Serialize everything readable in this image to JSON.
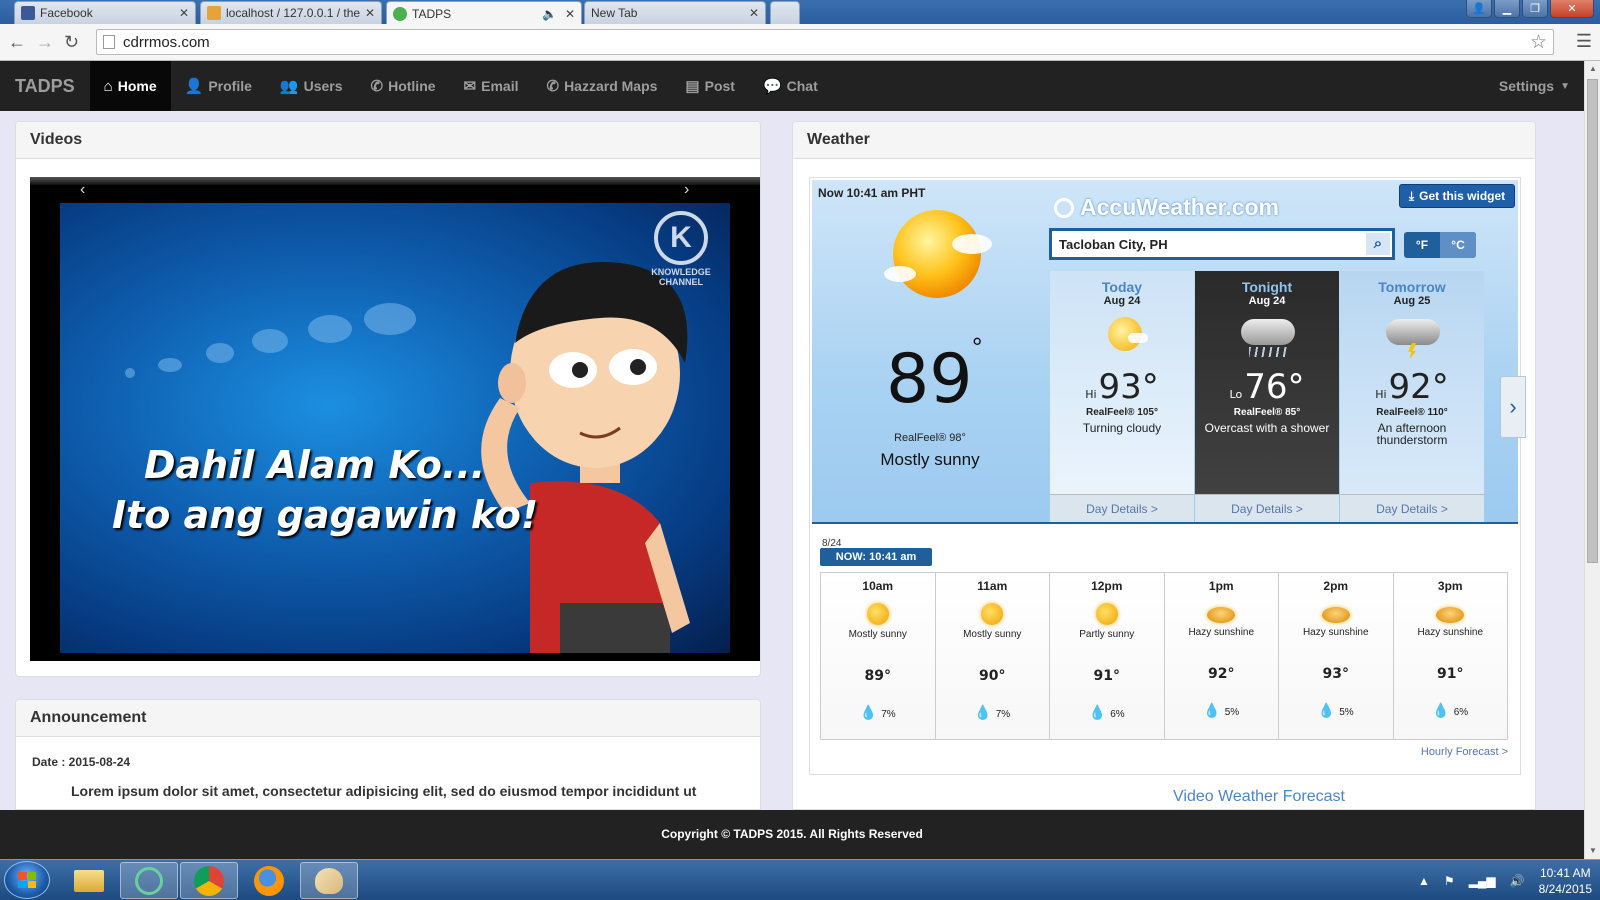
{
  "browser": {
    "tabs": [
      {
        "label": "Facebook",
        "active": false
      },
      {
        "label": "localhost / 127.0.0.1 / the",
        "active": false
      },
      {
        "label": "TADPS",
        "active": true
      },
      {
        "label": "New Tab",
        "active": false
      }
    ],
    "url": "cdrrmos.com"
  },
  "navbar": {
    "brand": "TADPS",
    "items": [
      {
        "label": "Home",
        "icon": "home-icon",
        "active": true
      },
      {
        "label": "Profile",
        "icon": "user-icon"
      },
      {
        "label": "Users",
        "icon": "users-icon"
      },
      {
        "label": "Hotline",
        "icon": "phone-icon"
      },
      {
        "label": "Email",
        "icon": "envelope-icon"
      },
      {
        "label": "Hazzard Maps",
        "icon": "phone-icon"
      },
      {
        "label": "Post",
        "icon": "file-icon"
      },
      {
        "label": "Chat",
        "icon": "comment-icon"
      }
    ],
    "settings": "Settings"
  },
  "videos": {
    "title": "Videos",
    "caption_line1": "Dahil Alam Ko...",
    "caption_line2": "Ito ang gagawin ko!",
    "logo_text": "KNOWLEDGE CHANNEL"
  },
  "announcement": {
    "title": "Announcement",
    "date": "Date : 2015-08-24",
    "body": "Lorem ipsum dolor sit amet, consectetur adipisicing elit, sed do eiusmod tempor incididunt ut"
  },
  "weather": {
    "title": "Weather",
    "now_label": "Now 10:41 am PHT",
    "current_temp": "89",
    "degree_symbol": "°",
    "realfeel": "RealFeel® 98°",
    "condition": "Mostly sunny",
    "brand": "AccuWeather.com",
    "get_widget": "Get this widget",
    "city": "Tacloban City, PH",
    "unit_f": "°F",
    "unit_c": "°C",
    "days": [
      {
        "name": "Today",
        "date": "Aug 24",
        "prefix": "Hi",
        "temp": "93°",
        "realfeel": "RealFeel® 105°",
        "desc": "Turning cloudy",
        "details": "Day Details >"
      },
      {
        "name": "Tonight",
        "date": "Aug 24",
        "prefix": "Lo",
        "temp": "76°",
        "realfeel": "RealFeel® 85°",
        "desc": "Overcast with a shower",
        "details": "Day Details >"
      },
      {
        "name": "Tomorrow",
        "date": "Aug 25",
        "prefix": "Hi",
        "temp": "92°",
        "realfeel": "RealFeel® 110°",
        "desc": "An afternoon thunderstorm",
        "details": "Day Details >"
      }
    ],
    "hourly_date": "8/24",
    "now_pill": "NOW: 10:41 am",
    "hours": [
      {
        "time": "10am",
        "cond": "Mostly sunny",
        "temp": "89°",
        "precip": "7%"
      },
      {
        "time": "11am",
        "cond": "Mostly sunny",
        "temp": "90°",
        "precip": "7%"
      },
      {
        "time": "12pm",
        "cond": "Partly sunny",
        "temp": "91°",
        "precip": "6%"
      },
      {
        "time": "1pm",
        "cond": "Hazy sunshine",
        "temp": "92°",
        "precip": "5%"
      },
      {
        "time": "2pm",
        "cond": "Hazy sunshine",
        "temp": "93°",
        "precip": "5%"
      },
      {
        "time": "3pm",
        "cond": "Hazy sunshine",
        "temp": "91°",
        "precip": "6%"
      }
    ],
    "hourly_forecast_link": "Hourly Forecast >",
    "video_forecast": "Video Weather Forecast"
  },
  "footer": "Copyright © TADPS 2015. All Rights Reserved",
  "taskbar": {
    "time": "10:41 AM",
    "date": "8/24/2015"
  }
}
